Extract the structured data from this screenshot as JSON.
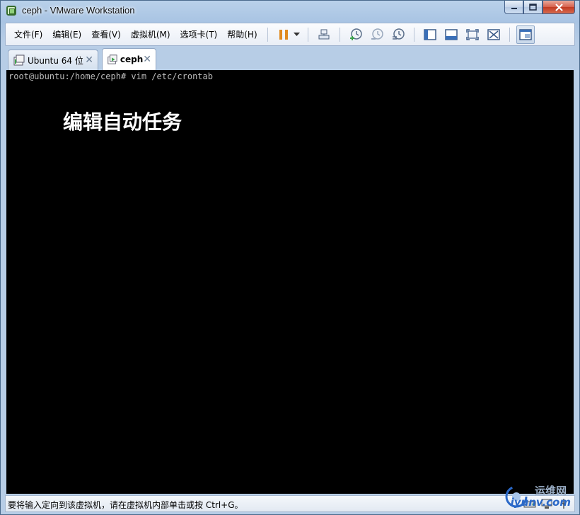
{
  "window": {
    "title": "ceph - VMware Workstation",
    "controls": {
      "minimize": "▁",
      "maximize": "□",
      "close": "✕"
    }
  },
  "menu": [
    {
      "label": "文件(F)"
    },
    {
      "label": "编辑(E)"
    },
    {
      "label": "查看(V)"
    },
    {
      "label": "虚拟机(M)"
    },
    {
      "label": "选项卡(T)"
    },
    {
      "label": "帮助(H)"
    }
  ],
  "toolbar": {
    "icons": [
      "pause-icon",
      "dropdown-arrow-icon",
      "send-ctrl-alt-del-icon",
      "snapshot-take-icon",
      "snapshot-revert-icon",
      "snapshot-manager-icon",
      "show-library-icon",
      "thumbnail-bar-icon",
      "fullscreen-icon",
      "unity-icon",
      "console-view-icon"
    ]
  },
  "tabs": [
    {
      "label": "Ubuntu 64 位",
      "close": "✕",
      "active": false
    },
    {
      "label": "ceph",
      "close": "✕",
      "active": true
    }
  ],
  "console": {
    "prompt_line": "root@ubuntu:/home/ceph# vim /etc/crontab",
    "annotation": "编辑自动任务",
    "background": "#000000",
    "text_color": "#bcbcbc"
  },
  "status": {
    "text": "要将输入定向到该虚拟机，请在虚拟机内部单击或按 Ctrl+G。",
    "icons": [
      "hard-disk-icon",
      "network-icon",
      "usb-icon"
    ]
  },
  "watermark": {
    "cn": "运维网",
    "en": "iyunv.com"
  },
  "colors": {
    "accent": "#e08a1e",
    "frame": "#b9d1ea"
  }
}
